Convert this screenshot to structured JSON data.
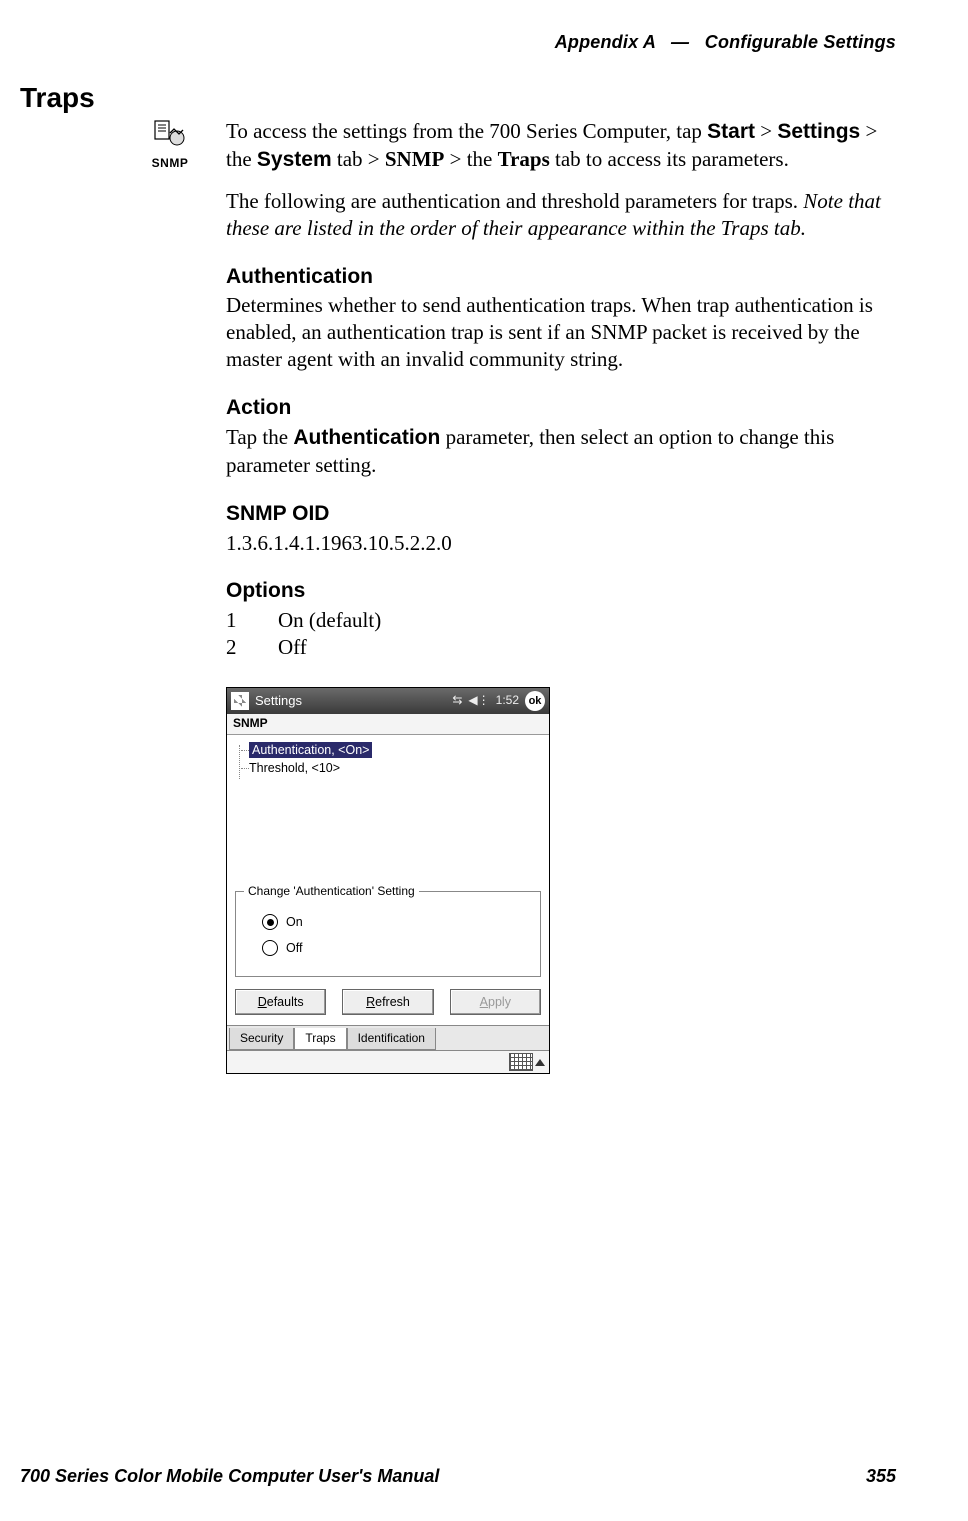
{
  "header": {
    "appendix": "Appendix A",
    "sep": "—",
    "title": "Configurable Settings"
  },
  "footer": {
    "manual": "700 Series Color Mobile Computer User's Manual",
    "page": "355"
  },
  "section_title": "Traps",
  "icon": {
    "label": "SNMP"
  },
  "intro": {
    "p1_a": "To access the settings from the 700 Series Computer, tap ",
    "p1_start": "Start",
    "p1_gt1": " > ",
    "p1_settings": "Settings",
    "p1_gt2": " > the ",
    "p1_system": "System",
    "p1_tab1": " tab > ",
    "p1_snmp": "SNMP",
    "p1_gt3": " > the ",
    "p1_traps": "Traps",
    "p1_end": " tab to access its parameters.",
    "p2_a": "The following are authentication and threshold parameters for traps. ",
    "p2_em": "Note that these are listed in the order of their appearance within the Traps tab."
  },
  "auth": {
    "h": "Authentication",
    "p": "Determines whether to send authentication traps. When trap authentication is enabled, an authentication trap is sent if an SNMP packet is received by the master agent with an invalid community string."
  },
  "action": {
    "h": "Action",
    "p_a": "Tap the ",
    "p_b": "Authentication",
    "p_c": " parameter, then select an option to change this parameter setting."
  },
  "oid": {
    "h": "SNMP OID",
    "value": "1.3.6.1.4.1.1963.10.5.2.2.0"
  },
  "options": {
    "h": "Options",
    "items": [
      {
        "num": "1",
        "label": "On (default)"
      },
      {
        "num": "2",
        "label": "Off"
      }
    ]
  },
  "device": {
    "title": "Settings",
    "time": "1:52",
    "ok": "ok",
    "subtitle": "SNMP",
    "tree": [
      {
        "label": "Authentication, <On>",
        "selected": true
      },
      {
        "label": "Threshold, <10>",
        "selected": false
      }
    ],
    "group_legend": "Change 'Authentication' Setting",
    "radios": [
      {
        "label": "On",
        "checked": true
      },
      {
        "label": "Off",
        "checked": false
      }
    ],
    "buttons": {
      "defaults_u": "D",
      "defaults_r": "efaults",
      "refresh_u": "R",
      "refresh_r": "efresh",
      "apply_u": "A",
      "apply_r": "pply"
    },
    "tabs": [
      {
        "label": "Security",
        "active": false
      },
      {
        "label": "Traps",
        "active": true
      },
      {
        "label": "Identification",
        "active": false
      }
    ]
  }
}
